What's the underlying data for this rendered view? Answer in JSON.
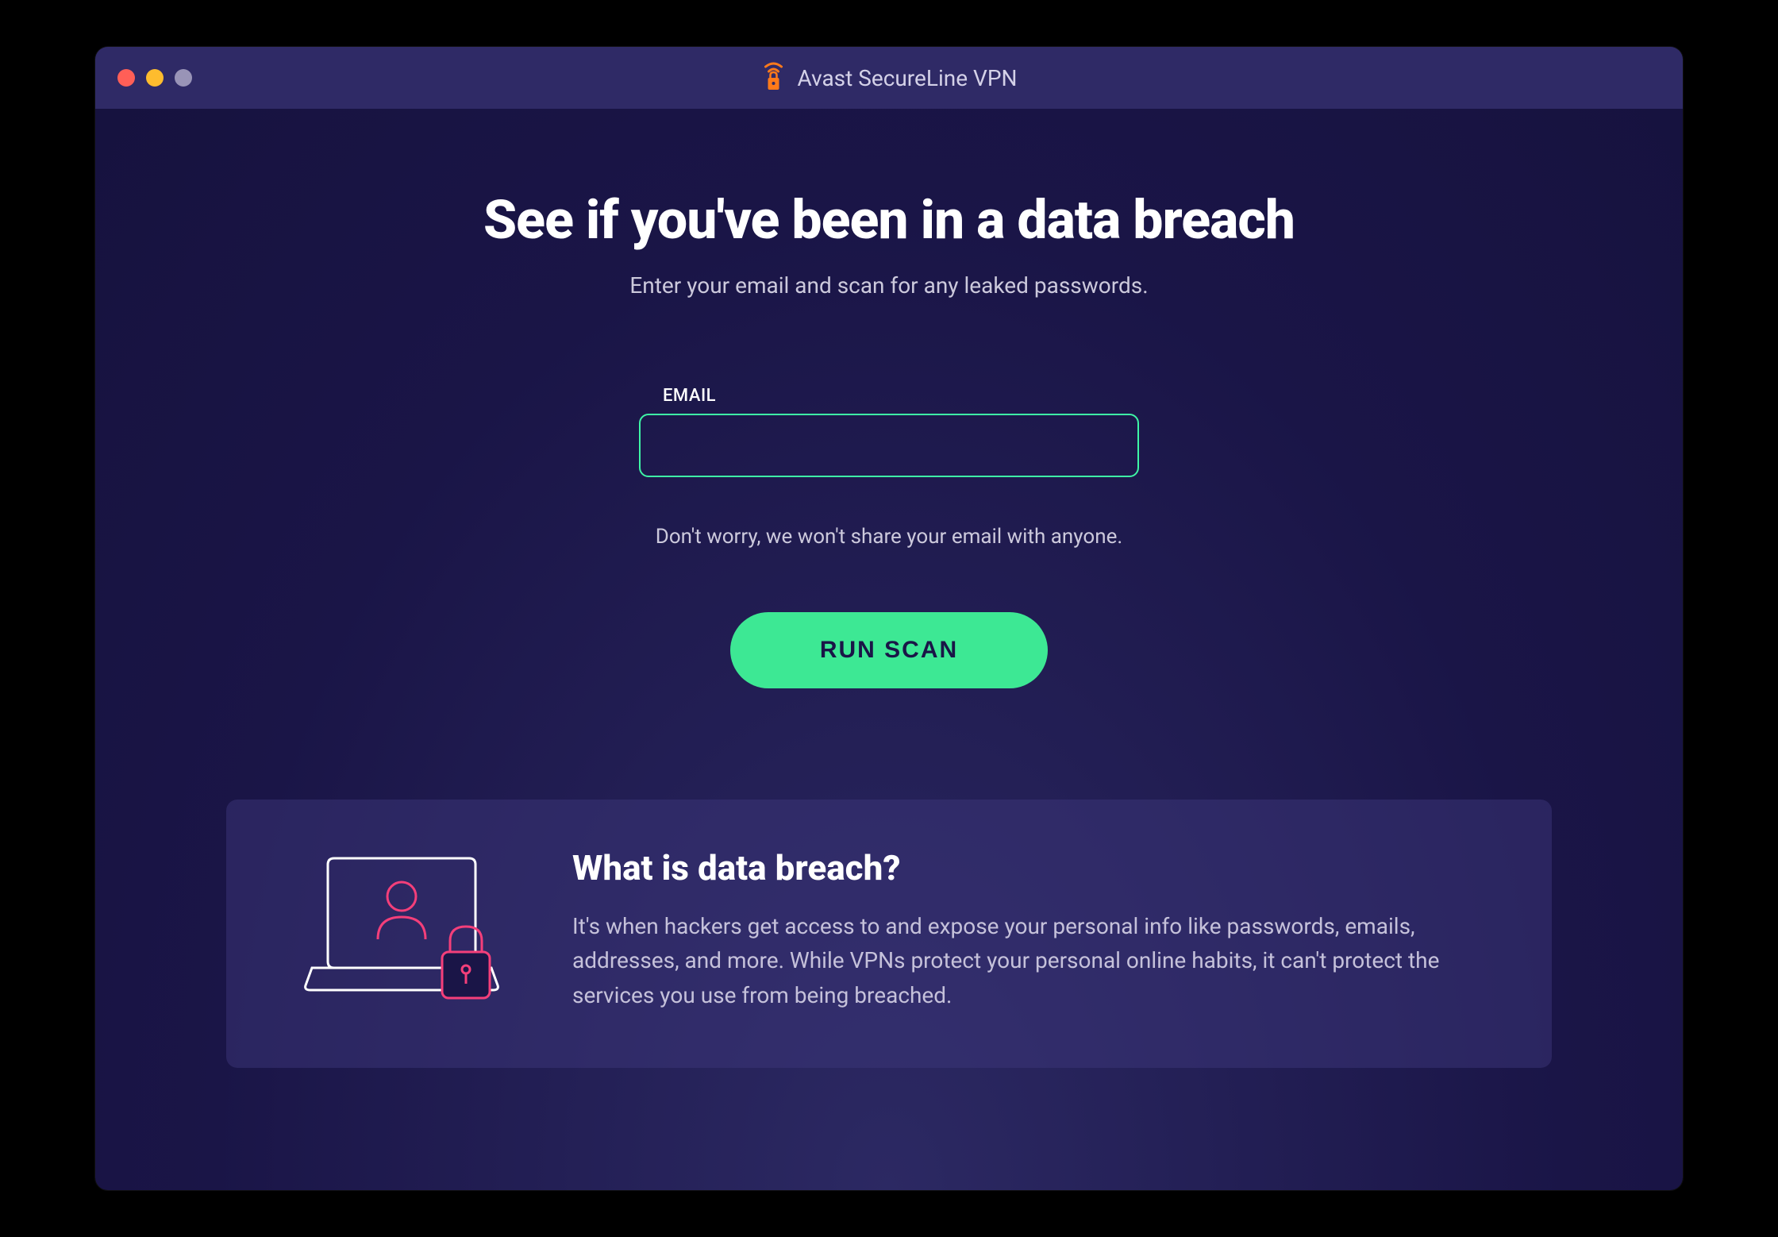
{
  "titlebar": {
    "app_name": "Avast SecureLine VPN"
  },
  "main": {
    "heading": "See if you've been in a data breach",
    "subheading": "Enter your email and scan for any leaked passwords.",
    "email_label": "EMAIL",
    "email_value": "",
    "reassurance": "Don't worry, we won't share your email with anyone.",
    "run_scan_label": "RUN SCAN"
  },
  "info": {
    "heading": "What is data breach?",
    "body": "It's when hackers get access to and expose your personal info like passwords, emails, addresses, and more. While VPNs protect your personal online habits, it can't protect the services you use from being breached."
  },
  "colors": {
    "accent_green": "#3de894",
    "border_green": "#3ef5a6",
    "bg_dark": "#1a1547",
    "titlebar": "#2f2a66",
    "pink": "#f43f7a"
  }
}
